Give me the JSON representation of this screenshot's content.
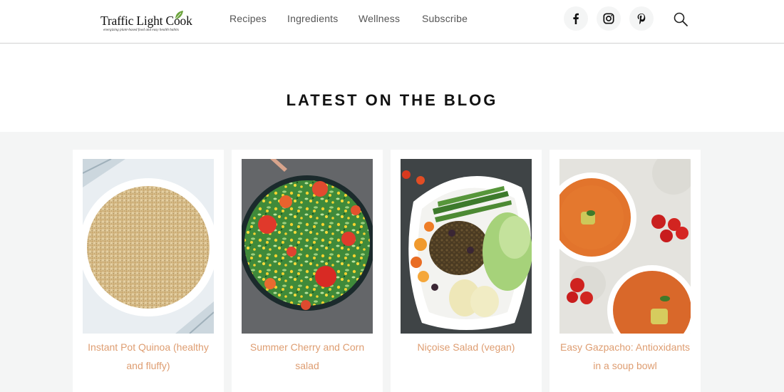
{
  "brand": {
    "name": "Traffic Light Cook",
    "tagline": "energizing plant-based food and easy health habits"
  },
  "nav": {
    "items": [
      {
        "label": "Recipes"
      },
      {
        "label": "Ingredients"
      },
      {
        "label": "Wellness"
      },
      {
        "label": "Subscribe"
      }
    ]
  },
  "social": [
    "facebook-icon",
    "instagram-icon",
    "pinterest-icon"
  ],
  "section": {
    "title": "LATEST ON THE BLOG"
  },
  "posts": [
    {
      "title": "Instant Pot Quinoa (healthy and fluffy)"
    },
    {
      "title": "Summer Cherry and Corn salad"
    },
    {
      "title": "Niçoise Salad (vegan)"
    },
    {
      "title": "Easy Gazpacho: Antioxidants in a soup bowl"
    }
  ],
  "colors": {
    "accent": "#de9d71",
    "background": "#f4f5f5",
    "leaf": "#6aa33a"
  }
}
